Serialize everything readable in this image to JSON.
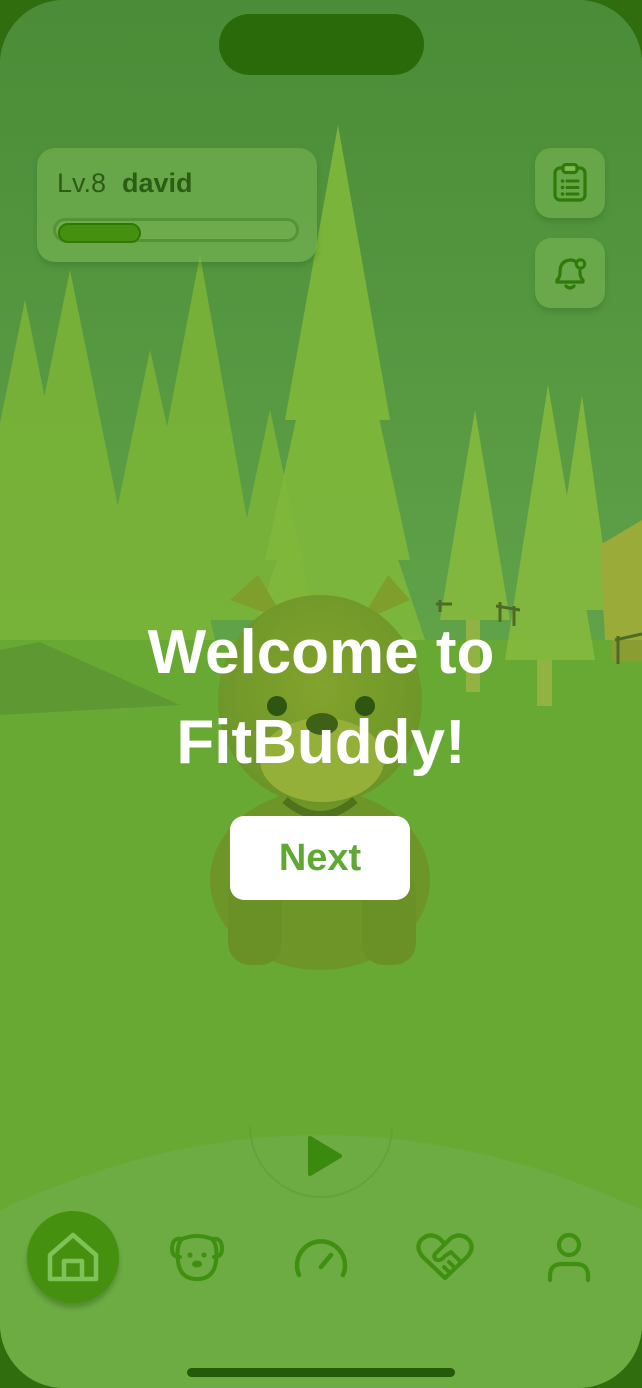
{
  "user": {
    "level_label": "Lv.8",
    "name": "david",
    "xp_progress": 0.35
  },
  "side_buttons": {
    "tasks_icon": "clipboard-list-icon",
    "notifications_icon": "bell-badge-icon"
  },
  "welcome": {
    "title_line1": "Welcome to",
    "title_line2": "FitBuddy!",
    "next_label": "Next"
  },
  "tabbar": {
    "play_icon": "play-icon",
    "items": [
      {
        "id": "home",
        "icon": "home-icon",
        "active": true
      },
      {
        "id": "pet",
        "icon": "dog-face-icon",
        "active": false
      },
      {
        "id": "activity",
        "icon": "speedometer-icon",
        "active": false
      },
      {
        "id": "health",
        "icon": "heart-handshake-icon",
        "active": false
      },
      {
        "id": "profile",
        "icon": "user-icon",
        "active": false
      }
    ]
  },
  "colors": {
    "accent": "#46900f",
    "icon": "#2f7a08",
    "button_text": "#5fa833"
  }
}
